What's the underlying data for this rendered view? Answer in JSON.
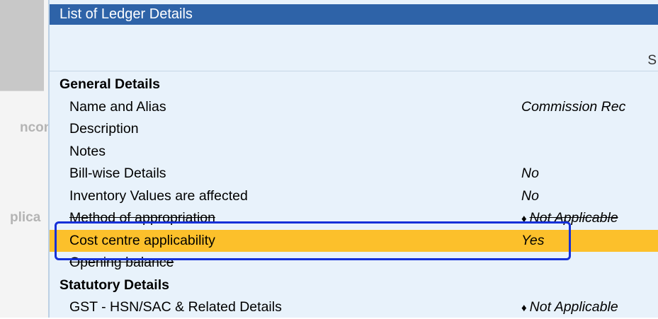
{
  "side_fragments": {
    "top": "ncon",
    "bottom": "plica"
  },
  "panel": {
    "title": "List of Ledger Details",
    "header_fragment": "S"
  },
  "rows": [
    {
      "label": "General Details",
      "value": ""
    },
    {
      "label": "Name and Alias",
      "value": "Commission Rec"
    },
    {
      "label": "Description",
      "value": ""
    },
    {
      "label": "Notes",
      "value": ""
    },
    {
      "label": "Bill-wise Details",
      "value": "No"
    },
    {
      "label": "Inventory Values are affected",
      "value": "No"
    },
    {
      "label": "Method of appropriation",
      "value": "Not Applicable"
    },
    {
      "label": "Cost centre applicability",
      "value": "Yes"
    },
    {
      "label": "Opening balance",
      "value": ""
    },
    {
      "label": "Statutory Details",
      "value": ""
    },
    {
      "label": "GST - HSN/SAC & Related Details",
      "value": "Not Applicable"
    }
  ],
  "bullet": "♦",
  "colors": {
    "title_bar": "#2e63a8",
    "panel_bg": "#e8f2fb",
    "highlight_row": "#fcc02b",
    "annotation_box": "#1530d8"
  }
}
